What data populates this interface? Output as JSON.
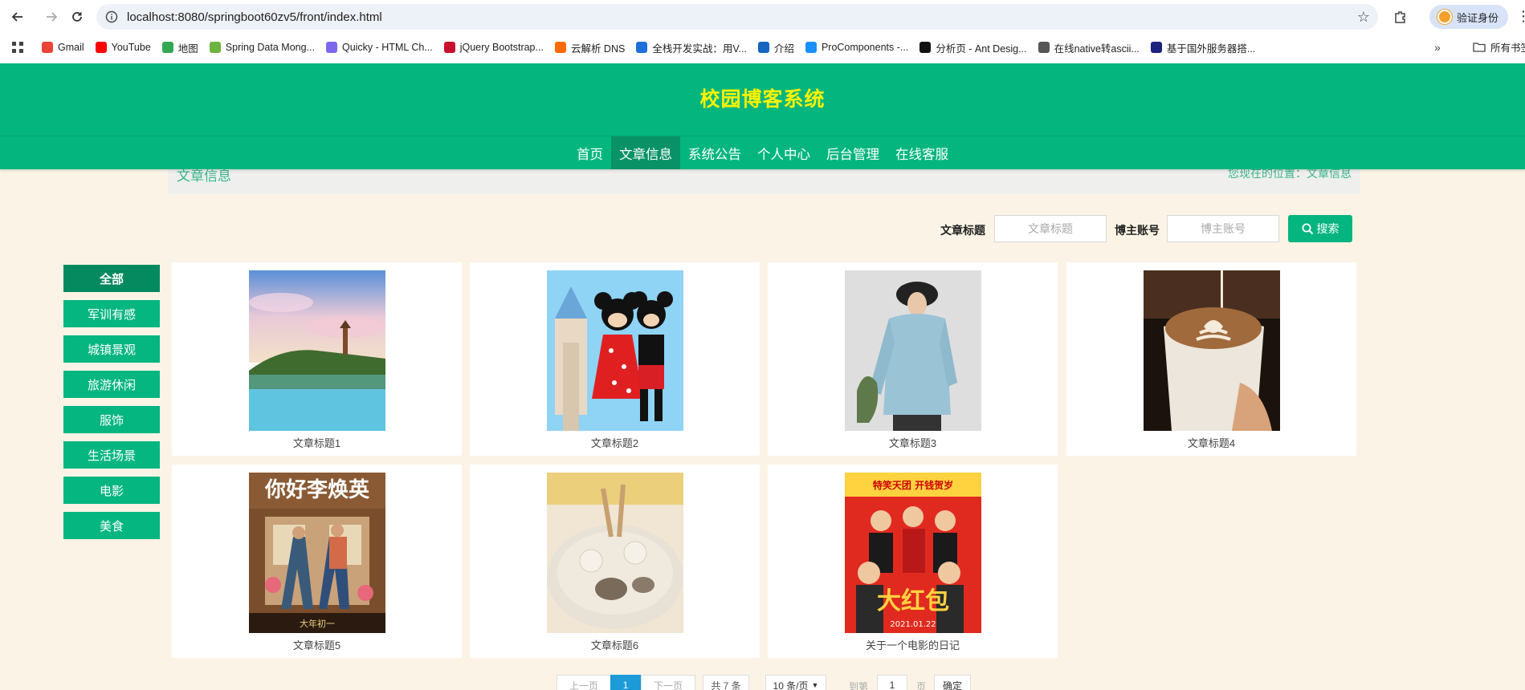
{
  "browser": {
    "url": "localhost:8080/springboot60zv5/front/index.html",
    "profile_label": "验证身份",
    "bookmarks": [
      {
        "label": "Gmail",
        "icon": "gmail-icon",
        "color": "#ea4335"
      },
      {
        "label": "YouTube",
        "icon": "youtube-icon",
        "color": "#ff0000"
      },
      {
        "label": "地图",
        "icon": "maps-icon",
        "color": "#34a853"
      },
      {
        "label": "Spring Data Mong...",
        "icon": "spring-icon",
        "color": "#6db33f"
      },
      {
        "label": "Quicky - HTML Ch...",
        "icon": "quicky-icon",
        "color": "#7b68ee"
      },
      {
        "label": "jQuery Bootstrap...",
        "icon": "jquery-icon",
        "color": "#c8102e"
      },
      {
        "label": "云解析 DNS",
        "icon": "aliyun-icon",
        "color": "#ff6a00"
      },
      {
        "label": "全栈开发实战：用V...",
        "icon": "m-icon",
        "color": "#1e6fd9"
      },
      {
        "label": "介绍",
        "icon": "globe-icon",
        "color": "#1565c0"
      },
      {
        "label": "ProComponents -...",
        "icon": "procomponents-icon",
        "color": "#1890ff"
      },
      {
        "label": "分析页 - Ant Desig...",
        "icon": "pro-icon",
        "color": "#111111"
      },
      {
        "label": "在线native转ascii...",
        "icon": "world-icon",
        "color": "#555555"
      },
      {
        "label": "基于国外服务器搭...",
        "icon": "flag-icon",
        "color": "#1a237e"
      }
    ],
    "bookmarks_folder": "所有书签"
  },
  "site": {
    "title": "校园博客系统",
    "nav": [
      "首页",
      "文章信息",
      "系统公告",
      "个人中心",
      "后台管理",
      "在线客服"
    ],
    "active_nav": 1
  },
  "breadcrumb": {
    "title": "文章信息",
    "location": "您现在的位置：文章信息"
  },
  "search": {
    "title_label": "文章标题",
    "title_placeholder": "文章标题",
    "author_label": "博主账号",
    "author_placeholder": "博主账号",
    "button": "搜索"
  },
  "categories": [
    "全部",
    "军训有感",
    "城镇景观",
    "旅游休闲",
    "服饰",
    "生活场景",
    "电影",
    "美食"
  ],
  "active_category": 0,
  "articles": [
    {
      "title": "文章标题1",
      "image": "lake-pagoda-landscape"
    },
    {
      "title": "文章标题2",
      "image": "mickey-minnie-castle"
    },
    {
      "title": "文章标题3",
      "image": "woman-blue-hoodie"
    },
    {
      "title": "文章标题4",
      "image": "latte-art-coffee"
    },
    {
      "title": "文章标题5",
      "image": "movie-poster-hi-mom"
    },
    {
      "title": "文章标题6",
      "image": "lotus-root-soup"
    },
    {
      "title": "关于一个电影的日记",
      "image": "movie-poster-red-envelope"
    }
  ],
  "pagination": {
    "prev": "上一页",
    "current": "1",
    "next": "下一页",
    "total": "共 7 条",
    "page_size": "10 条/页",
    "goto_prefix": "到第",
    "goto_value": "1",
    "goto_suffix": "页",
    "confirm": "确定"
  }
}
